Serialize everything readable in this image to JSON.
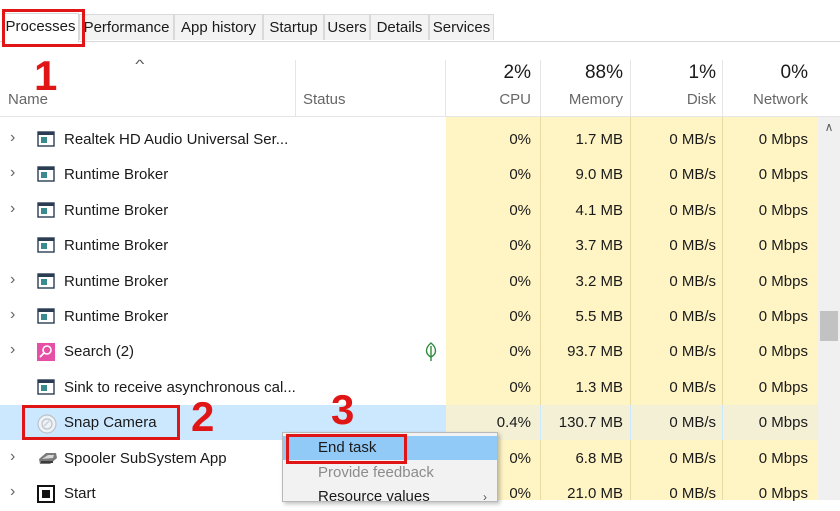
{
  "tabs": [
    {
      "label": "Processes",
      "active": true
    },
    {
      "label": "Performance"
    },
    {
      "label": "App history"
    },
    {
      "label": "Startup"
    },
    {
      "label": "Users"
    },
    {
      "label": "Details"
    },
    {
      "label": "Services"
    }
  ],
  "header": {
    "name_label": "Name",
    "status_label": "Status",
    "cpu": {
      "percent": "2%",
      "label": "CPU"
    },
    "memory": {
      "percent": "88%",
      "label": "Memory"
    },
    "disk": {
      "percent": "1%",
      "label": "Disk"
    },
    "network": {
      "percent": "0%",
      "label": "Network"
    }
  },
  "processes": [
    {
      "name": "Realtek HD Audio Universal Ser...",
      "cpu": "0%",
      "memory": "1.7 MB",
      "disk": "0 MB/s",
      "network": "0 Mbps",
      "icon": "app-window-icon",
      "expandable": true
    },
    {
      "name": "Runtime Broker",
      "cpu": "0%",
      "memory": "9.0 MB",
      "disk": "0 MB/s",
      "network": "0 Mbps",
      "icon": "app-window-icon",
      "expandable": true
    },
    {
      "name": "Runtime Broker",
      "cpu": "0%",
      "memory": "4.1 MB",
      "disk": "0 MB/s",
      "network": "0 Mbps",
      "icon": "app-window-icon",
      "expandable": true
    },
    {
      "name": "Runtime Broker",
      "cpu": "0%",
      "memory": "3.7 MB",
      "disk": "0 MB/s",
      "network": "0 Mbps",
      "icon": "app-window-icon",
      "expandable": false
    },
    {
      "name": "Runtime Broker",
      "cpu": "0%",
      "memory": "3.2 MB",
      "disk": "0 MB/s",
      "network": "0 Mbps",
      "icon": "app-window-icon",
      "expandable": true
    },
    {
      "name": "Runtime Broker",
      "cpu": "0%",
      "memory": "5.5 MB",
      "disk": "0 MB/s",
      "network": "0 Mbps",
      "icon": "app-window-icon",
      "expandable": true
    },
    {
      "name": "Search (2)",
      "cpu": "0%",
      "memory": "93.7 MB",
      "disk": "0 MB/s",
      "network": "0 Mbps",
      "icon": "search-app-icon",
      "expandable": true,
      "status_icon": "leaf-icon"
    },
    {
      "name": "Sink to receive asynchronous cal...",
      "cpu": "0%",
      "memory": "1.3 MB",
      "disk": "0 MB/s",
      "network": "0 Mbps",
      "icon": "app-window-icon",
      "expandable": false
    },
    {
      "name": "Snap Camera",
      "cpu": "0.4%",
      "memory": "130.7 MB",
      "disk": "0 MB/s",
      "network": "0 Mbps",
      "icon": "snap-camera-icon",
      "expandable": false,
      "selected": true
    },
    {
      "name": "Spooler SubSystem App",
      "cpu": "0%",
      "memory": "6.8 MB",
      "disk": "0 MB/s",
      "network": "0 Mbps",
      "icon": "printer-icon",
      "expandable": true
    },
    {
      "name": "Start",
      "cpu": "0%",
      "memory": "21.0 MB",
      "disk": "0 MB/s",
      "network": "0 Mbps",
      "icon": "start-app-icon",
      "expandable": true
    }
  ],
  "context_menu": {
    "items": [
      {
        "label": "End task",
        "state": "hover"
      },
      {
        "label": "Provide feedback",
        "state": "disabled"
      },
      {
        "label": "Resource values",
        "state": "normal",
        "submenu": true
      }
    ]
  },
  "annotations": {
    "step1": "1",
    "step2": "2",
    "step3": "3"
  },
  "colors": {
    "annotation": "#e01515",
    "heat_column": "#fff4c4",
    "selection": "#cce8ff",
    "menu_hover": "#91c9f7"
  }
}
